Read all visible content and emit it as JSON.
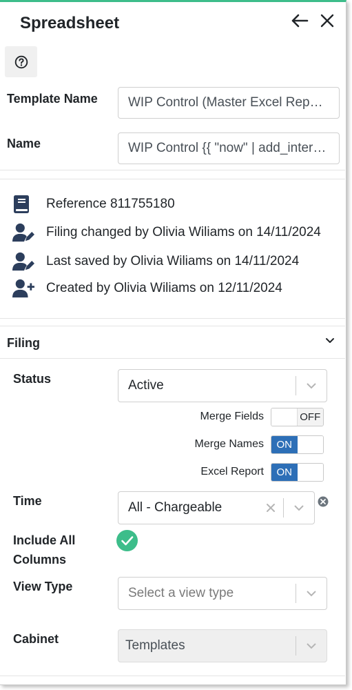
{
  "header": {
    "title": "Spreadsheet"
  },
  "details": {
    "template_name_label": "Template Name",
    "template_name_value": "WIP Control (Master Excel Report)",
    "name_label": "Name",
    "name_value": "WIP Control {{ \"now\" | add_interval: \"month\" }}"
  },
  "meta": {
    "reference": "Reference 811755180",
    "filing_changed": "Filing changed by Olivia Wiliams on 14/11/2024",
    "last_saved": "Last saved by Olivia Wiliams on 14/11/2024",
    "created": "Created by Olivia Wiliams on 12/11/2024"
  },
  "filing": {
    "section_title": "Filing",
    "status_label": "Status",
    "status_value": "Active",
    "merge_fields_label": "Merge Fields",
    "merge_fields_state": "OFF",
    "merge_names_label": "Merge Names",
    "merge_names_state": "ON",
    "excel_report_label": "Excel Report",
    "excel_report_state": "ON",
    "time_label": "Time",
    "time_value": "All - Chargeable",
    "include_all_label_1": "Include All",
    "include_all_label_2": "Columns",
    "view_type_label": "View Type",
    "view_type_placeholder": "Select a view type",
    "cabinet_label": "Cabinet",
    "cabinet_value": "Templates"
  },
  "colors": {
    "accent_top": "#3dbd8a",
    "toggle_on": "#2d6fb7",
    "check_green": "#3dbd8a",
    "icon_navy": "#2c3e5c"
  },
  "icons": [
    "arrow-left-icon",
    "close-icon",
    "help-circle-icon",
    "book-icon",
    "user-edit-icon",
    "user-plus-icon",
    "chevron-down-icon",
    "clear-x-icon",
    "clear-circle-icon",
    "check-circle-icon"
  ]
}
